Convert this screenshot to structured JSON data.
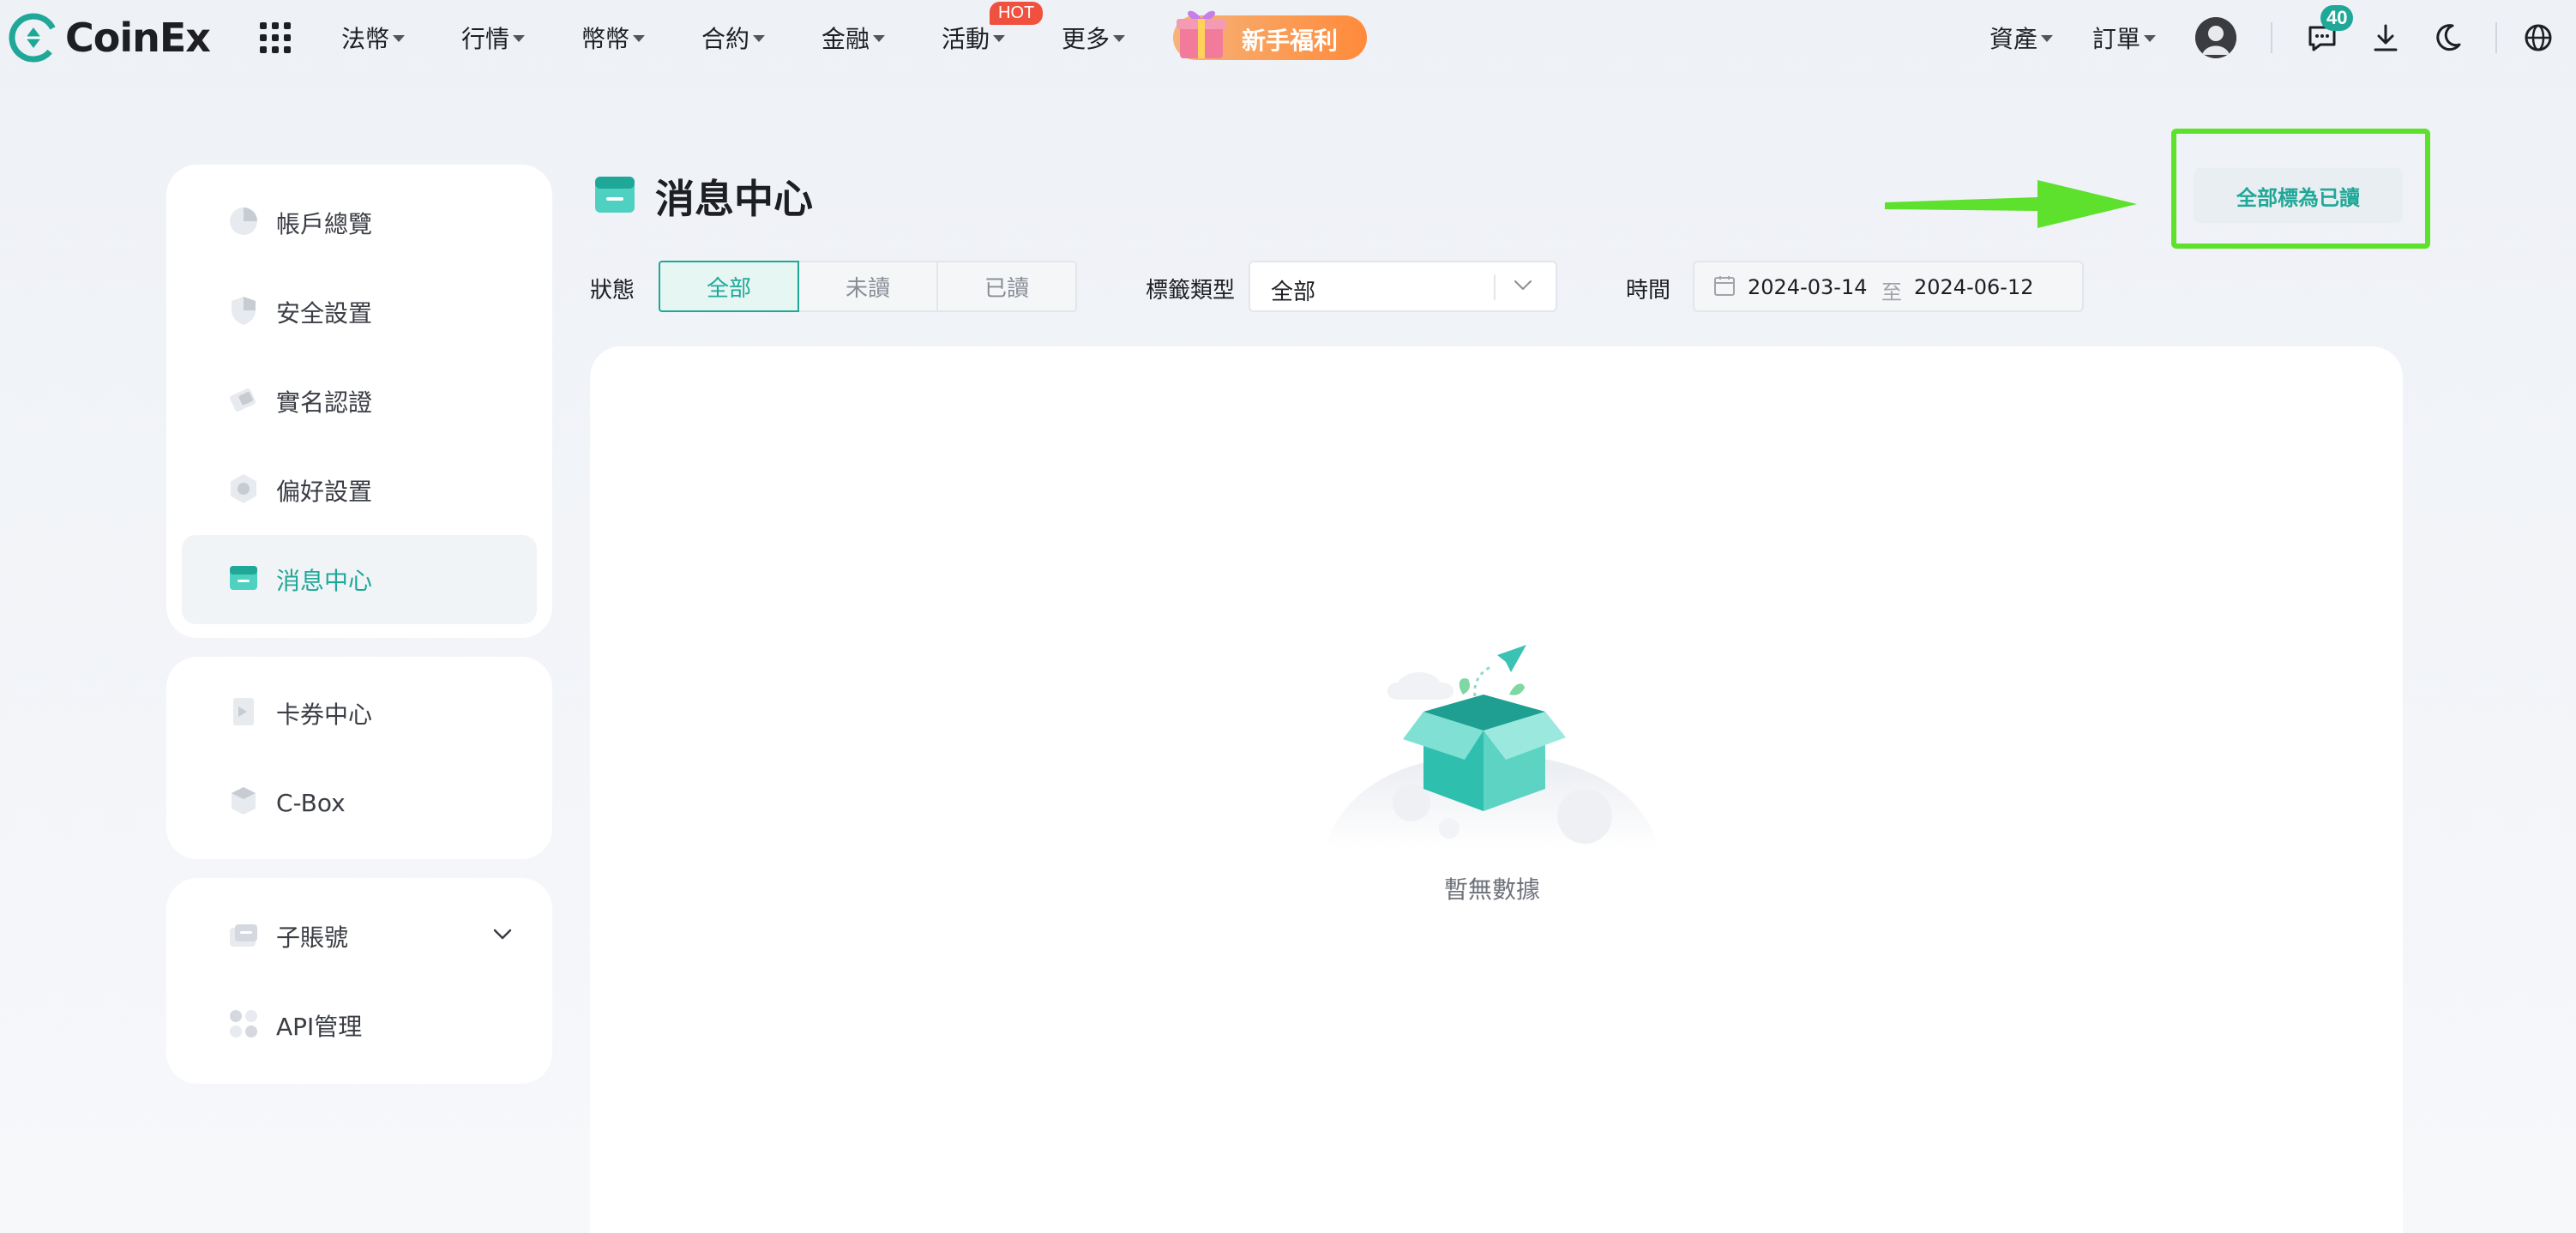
{
  "brand": {
    "name": "CoinEx"
  },
  "nav": {
    "items": [
      "法幣",
      "行情",
      "幣幣",
      "合約",
      "金融",
      "活動",
      "更多"
    ],
    "hot_badge": "HOT",
    "promo_label": "新手福利",
    "right": {
      "assets": "資產",
      "orders": "訂單"
    },
    "message_count": "40"
  },
  "sidebar": {
    "group1": [
      "帳戶總覽",
      "安全設置",
      "實名認證",
      "偏好設置",
      "消息中心"
    ],
    "group2": [
      "卡券中心",
      "C-Box"
    ],
    "group3": [
      "子賬號",
      "API管理"
    ],
    "active": "消息中心"
  },
  "page": {
    "title": "消息中心",
    "mark_all_read": "全部標為已讀"
  },
  "filters": {
    "status_label": "狀態",
    "status_options": [
      "全部",
      "未讀",
      "已讀"
    ],
    "status_selected": "全部",
    "tag_type_label": "標籤類型",
    "tag_type_value": "全部",
    "time_label": "時間",
    "date_start": "2024-03-14",
    "date_separator": "至",
    "date_end": "2024-06-12"
  },
  "empty_state": {
    "text": "暫無數據"
  },
  "colors": {
    "accent": "#1fa898",
    "highlight_border": "#5ee12c",
    "arrow": "#5ee12c",
    "hot": "#f0513e",
    "promo": "#ff8a3a"
  }
}
